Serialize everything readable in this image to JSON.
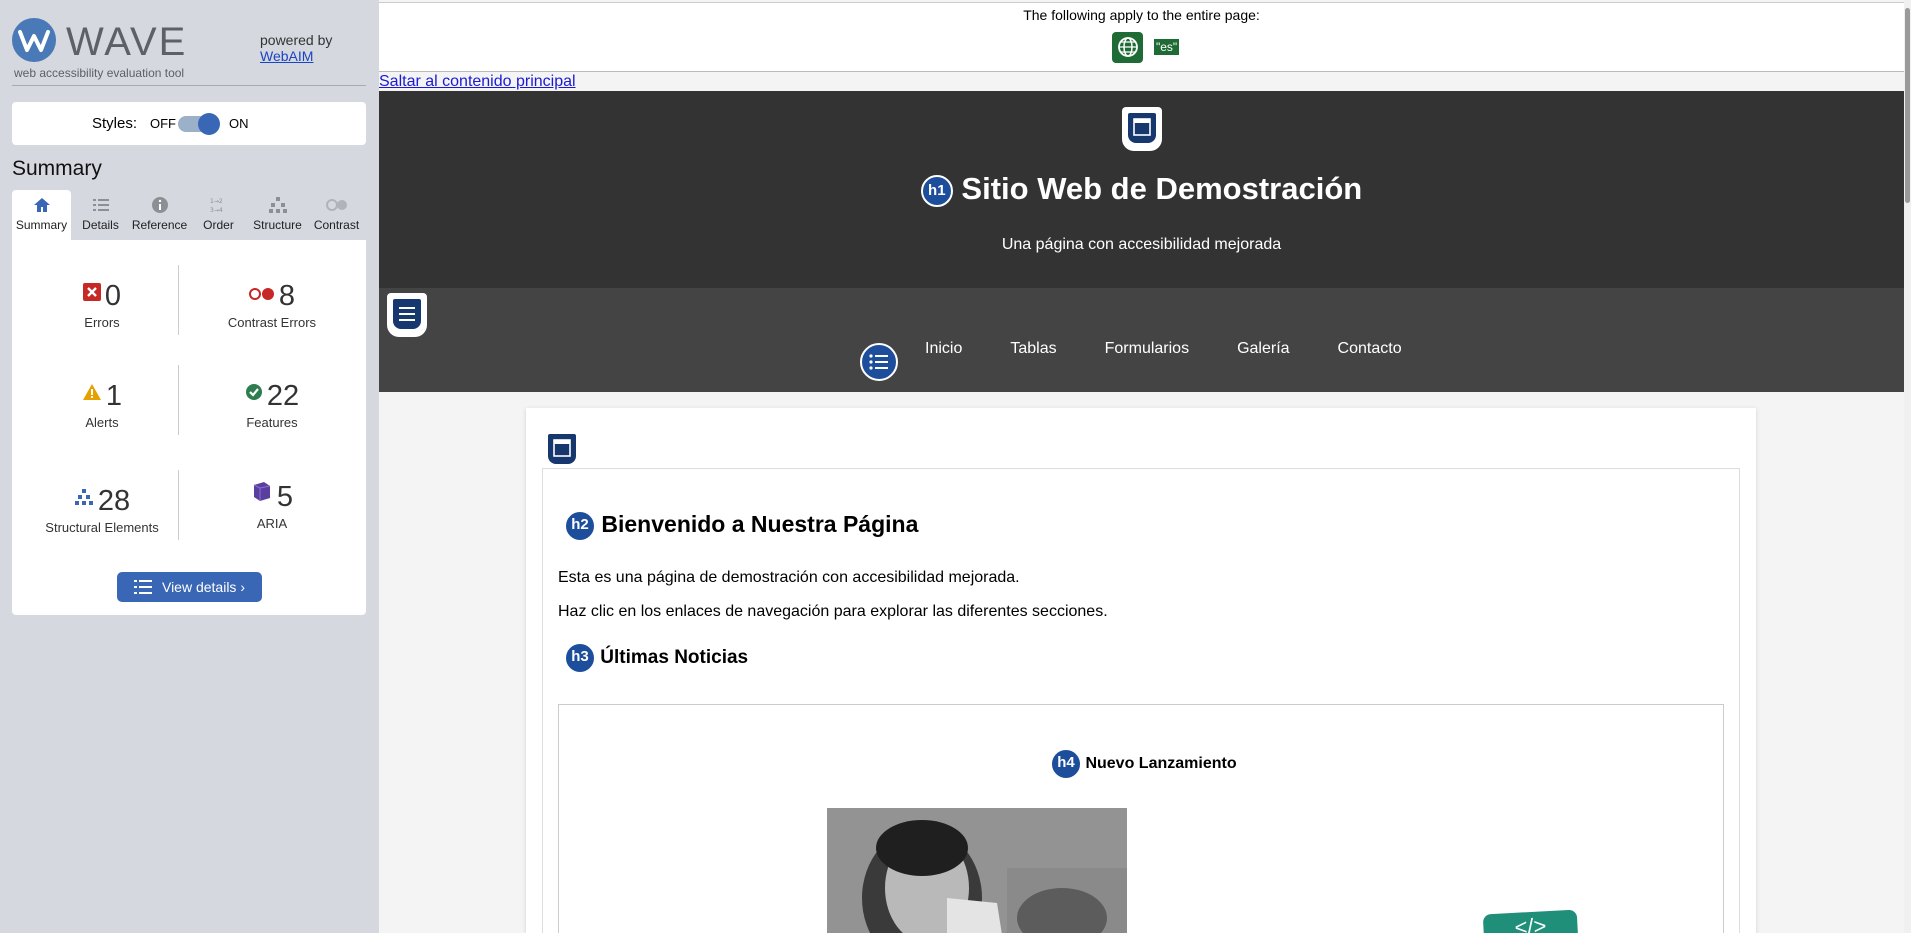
{
  "wave": {
    "brand_name": "WAVE",
    "brand_tagline": "web accessibility evaluation tool",
    "powered_by": "powered by",
    "powered_link": "WebAIM",
    "styles_label": "Styles:",
    "styles_off": "OFF",
    "styles_on": "ON",
    "styles_enabled": true,
    "summary_title": "Summary",
    "tabs": [
      {
        "label": "Summary",
        "icon": "home-icon",
        "active": true
      },
      {
        "label": "Details",
        "icon": "list-icon"
      },
      {
        "label": "Reference",
        "icon": "info-icon"
      },
      {
        "label": "Order",
        "icon": "order-icon"
      },
      {
        "label": "Structure",
        "icon": "structure-icon"
      },
      {
        "label": "Contrast",
        "icon": "contrast-icon"
      }
    ],
    "stats": [
      {
        "count": "0",
        "label": "Errors",
        "icon": "error-icon",
        "color": "#c62828"
      },
      {
        "count": "8",
        "label": "Contrast Errors",
        "icon": "contrast-error-icon",
        "color": "#c62828"
      },
      {
        "count": "1",
        "label": "Alerts",
        "icon": "alert-icon",
        "color": "#e6a100"
      },
      {
        "count": "22",
        "label": "Features",
        "icon": "feature-icon",
        "color": "#2e7d4f"
      },
      {
        "count": "28",
        "label": "Structural Elements",
        "icon": "structure-icon",
        "color": "#3a67b5"
      },
      {
        "count": "5",
        "label": "ARIA",
        "icon": "aria-icon",
        "color": "#5b3fa0"
      }
    ],
    "view_details": "View details ›"
  },
  "page": {
    "global_notice": "The following apply to the entire page:",
    "lang_value": "\"es\"",
    "skip_link": "Saltar al contenido principal",
    "site_title": "Sitio Web de Demostración",
    "site_subtitle": "Una página con accesibilidad mejorada",
    "h1_badge": "h1",
    "nav": [
      "Inicio",
      "Tablas",
      "Formularios",
      "Galería",
      "Contacto"
    ],
    "h2_badge": "h2",
    "h2_text": "Bienvenido a Nuestra Página",
    "para1": "Esta es una página de demostración con accesibilidad mejorada.",
    "para2": "Haz clic en los enlaces de navegación para explorar las diferentes secciones.",
    "h3_badge": "h3",
    "h3_text": "Últimas Noticias",
    "h4_badge": "h4",
    "h4_text": "Nuevo Lanzamiento",
    "code_badge": "</>"
  }
}
